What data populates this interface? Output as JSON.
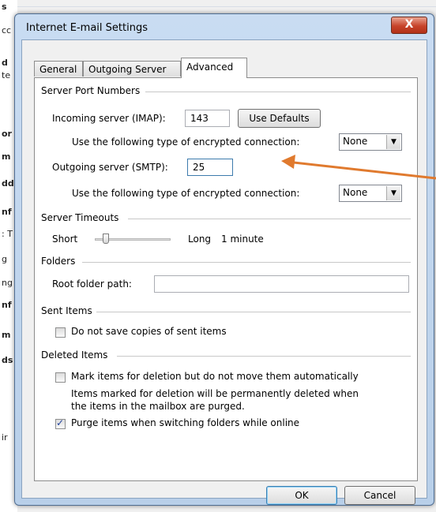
{
  "background": {
    "letters": [
      "s",
      "cc",
      "d",
      "te",
      "or",
      "m",
      "dd",
      "nf",
      ": T",
      "g",
      "ng",
      "nf",
      "m",
      "ds",
      "ir"
    ]
  },
  "dialog": {
    "title": "Internet E-mail Settings",
    "close_glyph": "X"
  },
  "tabs": [
    {
      "label": "General",
      "active": false
    },
    {
      "label": "Outgoing Server",
      "active": false
    },
    {
      "label": "Advanced",
      "active": true
    }
  ],
  "server_ports": {
    "group_label": "Server Port Numbers",
    "incoming_label": "Incoming server (IMAP):",
    "incoming_value": "143",
    "use_defaults_label": "Use Defaults",
    "incoming_encryption_label": "Use the following type of encrypted connection:",
    "incoming_encryption_value": "None",
    "outgoing_label": "Outgoing server (SMTP):",
    "outgoing_value": "25",
    "outgoing_encryption_label": "Use the following type of encrypted connection:",
    "outgoing_encryption_value": "None"
  },
  "timeouts": {
    "group_label": "Server Timeouts",
    "short_label": "Short",
    "long_label": "Long",
    "value_label": "1 minute",
    "slider_level": 0.1
  },
  "folders": {
    "group_label": "Folders",
    "root_label": "Root folder path:",
    "root_value": ""
  },
  "sent_items": {
    "group_label": "Sent Items",
    "no_copies_label": "Do not save copies of sent items",
    "no_copies_checked": false
  },
  "deleted_items": {
    "group_label": "Deleted Items",
    "mark_label": "Mark items for deletion but do not move them automatically",
    "mark_checked": false,
    "note_line1": "Items marked for deletion will be permanently deleted when",
    "note_line2": "the items in the mailbox are purged.",
    "purge_label": "Purge items when switching folders while online",
    "purge_checked": true
  },
  "footer": {
    "ok_label": "OK",
    "cancel_label": "Cancel"
  },
  "colors": {
    "annotation_arrow": "#e07a2e",
    "dialog_frame": "#b8cfe9",
    "close_button": "#c7432a"
  }
}
